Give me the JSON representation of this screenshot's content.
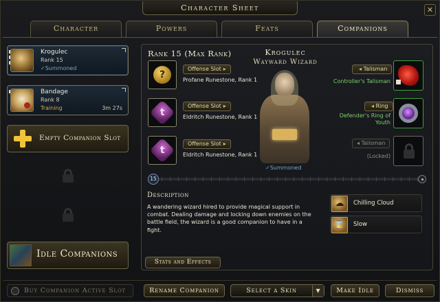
{
  "window": {
    "title": "Character Sheet",
    "close_label": "✕"
  },
  "tabs": [
    {
      "label": "Character"
    },
    {
      "label": "Powers"
    },
    {
      "label": "Feats"
    },
    {
      "label": "Companions",
      "active": true
    }
  ],
  "companions": [
    {
      "name": "Krogulec",
      "rank": "Rank 15",
      "status": "✓Summoned",
      "timer": ""
    },
    {
      "name": "Bandage",
      "rank": "Rank 8",
      "status": "Training",
      "timer": "3m 27s"
    }
  ],
  "empty_slot_label": "Empty Companion Slot",
  "idle_companions_label": "Idle Companions",
  "details": {
    "rank_title": "Rank 15 (Max Rank)",
    "name": "Krogulec",
    "class": "Wayward Wizard",
    "summoned": "✓Summoned",
    "runes": [
      {
        "slot": "Offense Slot",
        "name": "Profane Runestone, Rank 1",
        "glyph": "?"
      },
      {
        "slot": "Offense Slot",
        "name": "Eldritch Runestone, Rank 1",
        "glyph": "t"
      },
      {
        "slot": "Offense Slot",
        "name": "Eldritch Runestone, Rank 1",
        "glyph": "t"
      }
    ],
    "equipment": [
      {
        "slot": "Talisman",
        "name": "Controller's Talisman"
      },
      {
        "slot": "Ring",
        "name_line1": "Defender's Ring of",
        "name_line2": "Youth"
      },
      {
        "slot": "Talisman",
        "name": "(Locked)"
      }
    ],
    "rank_progress": {
      "current": "15",
      "fill": 1.0
    },
    "description_title": "Description",
    "description": "A wandering wizard hired to provide magical support in combat. Dealing damage and locking down enemies on the battle field, the wizard is a good companion to have in a fight.",
    "powers": [
      {
        "name": "Chilling Cloud"
      },
      {
        "name": "Slow"
      }
    ],
    "stats_button": "Stats and Effects"
  },
  "bottom": {
    "buy_slot": "Buy Companion Active Slot",
    "rename": "Rename Companion",
    "skin_select": "Select a Skin",
    "make_idle": "Make Idle",
    "dismiss": "Dismiss"
  },
  "colors": {
    "accent_gold": "#d8c074",
    "summoned_blue": "#7ea2c7",
    "training_orange": "#e3a64a",
    "item_green": "#7cd36a"
  }
}
